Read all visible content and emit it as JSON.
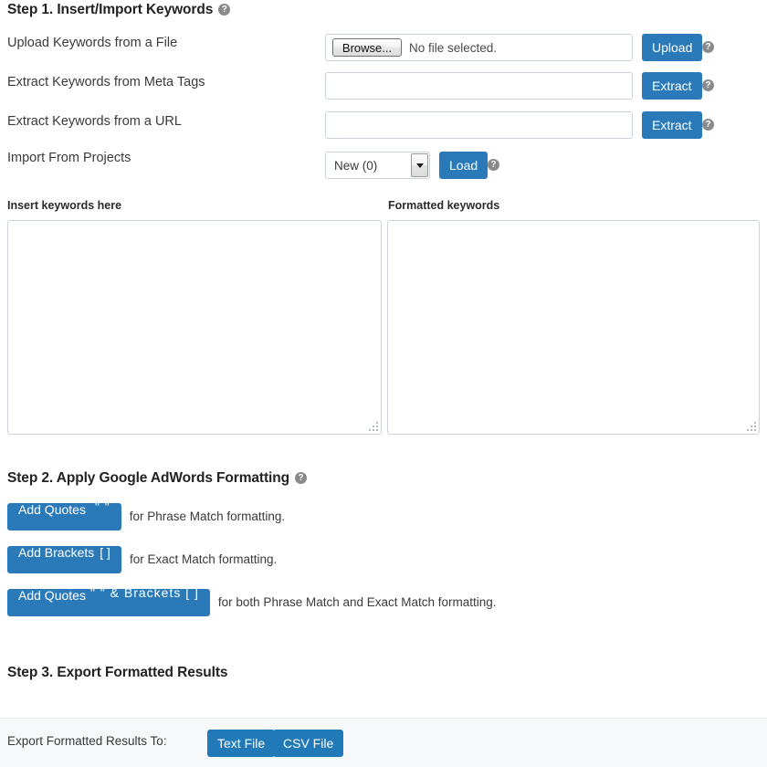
{
  "theme": {
    "accent_blue": "#2a7ab9",
    "panel_bg": "#f7f8fa",
    "border": "#ccd2dc",
    "help_icon_bg": "#8a8a8a"
  },
  "step1": {
    "heading": "Step 1. Insert/Import Keywords",
    "help_icon": "help-circle-icon",
    "rows": [
      {
        "label": "Upload Keywords from a File",
        "browse_label": "Browse...",
        "file_status": "No file selected.",
        "action_label": "Upload",
        "help_icon": "help-circle-icon"
      },
      {
        "label": "Extract Keywords from Meta Tags",
        "value": "",
        "placeholder": "",
        "action_label": "Extract",
        "help_icon": "help-circle-icon"
      },
      {
        "label": "Extract Keywords from a URL",
        "value": "",
        "placeholder": "",
        "action_label": "Extract",
        "help_icon": "help-circle-icon"
      },
      {
        "label": "Import From Projects",
        "select_value": "New (0)",
        "select_options": [
          "New (0)"
        ],
        "action_label": "Load",
        "help_icon": "help-circle-icon"
      }
    ],
    "input_left": {
      "label": "Insert keywords here",
      "value": "",
      "placeholder": ""
    },
    "input_right": {
      "label": "Formatted keywords",
      "value": "",
      "placeholder": ""
    }
  },
  "step2": {
    "heading": "Step 2. Apply Google AdWords Formatting",
    "help_icon": "help-circle-icon",
    "actions": [
      {
        "label": "Add Quotes",
        "symbol": "\" \"",
        "note": "for Phrase Match formatting."
      },
      {
        "label": "Add Brackets",
        "symbol": "[ ]",
        "note": "for Exact Match formatting."
      },
      {
        "label": "Add Quotes",
        "symbol": "\" \" & Brackets [ ]",
        "note": "for both Phrase Match and Exact Match formatting."
      }
    ]
  },
  "step3": {
    "heading": "Step 3. Export Formatted Results",
    "export_label": "Export Formatted Results To:",
    "buttons": [
      {
        "label": "Text File"
      },
      {
        "label": "CSV File"
      }
    ]
  }
}
